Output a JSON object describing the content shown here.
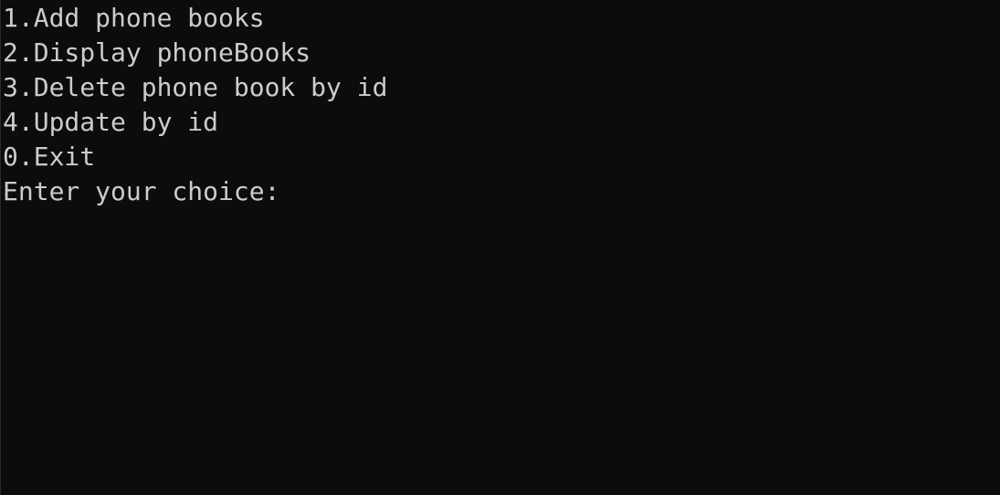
{
  "console": {
    "menu": [
      "1.Add phone books",
      "2.Display phoneBooks",
      "3.Delete phone book by id",
      "4.Update by id",
      "0.Exit"
    ],
    "prompt": "Enter your choice:",
    "input_value": ""
  },
  "colors": {
    "background": "#0c0c0c",
    "text": "#cccccc"
  }
}
